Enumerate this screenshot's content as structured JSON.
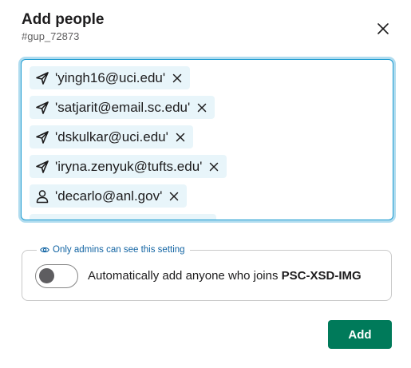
{
  "dialog": {
    "title": "Add people",
    "subtitle": "#gup_72873"
  },
  "recipients": [
    {
      "label": "'yingh16@uci.edu'",
      "icon": "send-icon"
    },
    {
      "label": "'satjarit@email.sc.edu'",
      "icon": "send-icon"
    },
    {
      "label": "'dskulkar@uci.edu'",
      "icon": "send-icon"
    },
    {
      "label": "'iryna.zenyuk@tufts.edu'",
      "icon": "send-icon"
    },
    {
      "label": "'decarlo@anl.gov'",
      "icon": "person-icon"
    }
  ],
  "settings": {
    "legend": "Only admins can see this setting",
    "toggle_on": false,
    "text_prefix": "Automatically add anyone who joins",
    "channel_name": "PSC-XSD-IMG"
  },
  "actions": {
    "add_label": "Add"
  },
  "colors": {
    "accent_focus": "#1d9bd1",
    "chip_bg": "#e8f5fa",
    "primary_button": "#007a5a",
    "legend_link": "#1264a3"
  }
}
